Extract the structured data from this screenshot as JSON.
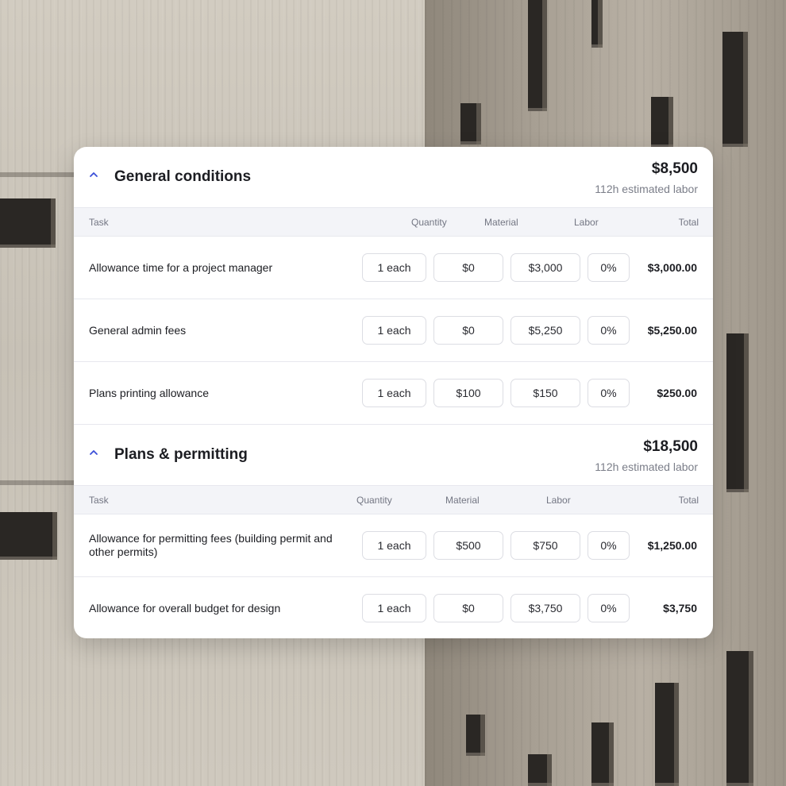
{
  "colors": {
    "accent": "#3b4fd8",
    "header_bg": "#f3f4f8",
    "border": "#e7e8ee"
  },
  "sections": [
    {
      "title": "General conditions",
      "total": "$8,500",
      "labor_summary": "112h estimated labor",
      "columns": {
        "task": "Task",
        "quantity": "Quantity",
        "material": "Material",
        "labor": "Labor",
        "total": "Total"
      },
      "rows": [
        {
          "task": "Allowance time for a project manager",
          "quantity": "1 each",
          "material": "$0",
          "labor": "$3,000",
          "markup": "0%",
          "total": "$3,000.00"
        },
        {
          "task": "General admin fees",
          "quantity": "1 each",
          "material": "$0",
          "labor": "$5,250",
          "markup": "0%",
          "total": "$5,250.00"
        },
        {
          "task": "Plans printing allowance",
          "quantity": "1 each",
          "material": "$100",
          "labor": "$150",
          "markup": "0%",
          "total": "$250.00"
        }
      ]
    },
    {
      "title": "Plans & permitting",
      "total": "$18,500",
      "labor_summary": "112h estimated labor",
      "columns": {
        "task": "Task",
        "quantity": "Quantity",
        "material": "Material",
        "labor": "Labor",
        "total": "Total"
      },
      "rows": [
        {
          "task": "Allowance for permitting fees (building permit and other permits)",
          "quantity": "1 each",
          "material": "$500",
          "labor": "$750",
          "markup": "0%",
          "total": "$1,250.00"
        },
        {
          "task": "Allowance for overall budget for design",
          "quantity": "1 each",
          "material": "$0",
          "labor": "$3,750",
          "markup": "0%",
          "total": "$3,750"
        }
      ]
    }
  ]
}
